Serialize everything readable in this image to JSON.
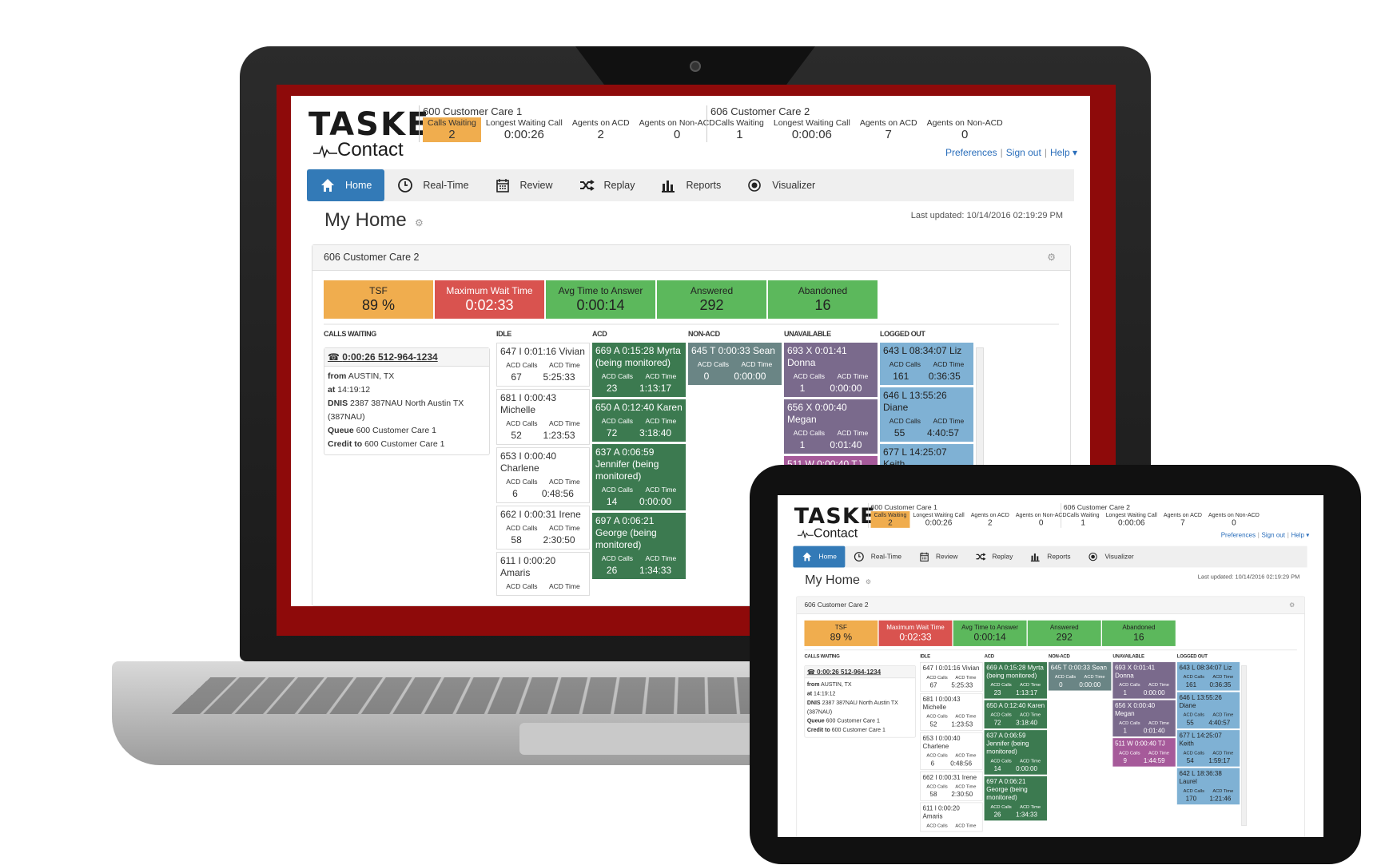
{
  "logo": {
    "line1": "TASKE",
    "line2": "Contact"
  },
  "queues": [
    {
      "title": "600 Customer Care 1",
      "stats": [
        {
          "label": "Calls Waiting",
          "value": "2",
          "highlight": true
        },
        {
          "label": "Longest Waiting Call",
          "value": "0:00:26"
        },
        {
          "label": "Agents on ACD",
          "value": "2"
        },
        {
          "label": "Agents on Non-ACD",
          "value": "0"
        }
      ]
    },
    {
      "title": "606 Customer Care 2",
      "stats": [
        {
          "label": "Calls Waiting",
          "value": "1"
        },
        {
          "label": "Longest Waiting Call",
          "value": "0:00:06"
        },
        {
          "label": "Agents on ACD",
          "value": "7"
        },
        {
          "label": "Agents on Non-ACD",
          "value": "0"
        }
      ]
    }
  ],
  "toplinks": {
    "preferences": "Preferences",
    "signout": "Sign out",
    "help": "Help ▾"
  },
  "nav": [
    {
      "label": "Home",
      "icon": "home-icon",
      "active": true
    },
    {
      "label": "Real-Time",
      "icon": "clock-icon"
    },
    {
      "label": "Review",
      "icon": "calendar-icon"
    },
    {
      "label": "Replay",
      "icon": "shuffle-icon"
    },
    {
      "label": "Reports",
      "icon": "bar-chart-icon"
    },
    {
      "label": "Visualizer",
      "icon": "eye-icon"
    }
  ],
  "page": {
    "title": "My Home",
    "gear": "⚙",
    "last_updated": "Last updated: 10/14/2016 02:19:29 PM"
  },
  "panel": {
    "title": "606 Customer Care 2",
    "gear": "⚙"
  },
  "kpis": [
    {
      "label": "TSF",
      "value": "89 %",
      "color": "orange"
    },
    {
      "label": "Maximum Wait Time",
      "value": "0:02:33",
      "color": "red"
    },
    {
      "label": "Avg Time to Answer",
      "value": "0:00:14",
      "color": "green"
    },
    {
      "label": "Answered",
      "value": "292",
      "color": "green"
    },
    {
      "label": "Abandoned",
      "value": "16",
      "color": "green"
    }
  ],
  "columns": {
    "calls_waiting": "CALLS WAITING",
    "idle": "IDLE",
    "acd": "ACD",
    "nonacd": "NON-ACD",
    "unavailable": "UNAVAILABLE",
    "logged_out": "LOGGED OUT"
  },
  "call": {
    "header": "0:00:26  512-964-1234",
    "from_label": "from",
    "from": "AUSTIN, TX",
    "at_label": "at",
    "at": "14:19:12",
    "dnis_label": "DNIS",
    "dnis": "2387 387NAU North Austin TX (387NAU)",
    "queue_label": "Queue",
    "queue": "600 Customer Care 1",
    "credit_label": "Credit to",
    "credit": "600 Customer Care 1"
  },
  "mini_labels": {
    "calls": "ACD Calls",
    "time": "ACD Time"
  },
  "agents": {
    "idle": [
      {
        "title": "647 I 0:01:16 Vivian",
        "calls": "67",
        "time": "5:25:33"
      },
      {
        "title": "681 I 0:00:43 Michelle",
        "calls": "52",
        "time": "1:23:53"
      },
      {
        "title": "653 I 0:00:40 Charlene",
        "calls": "6",
        "time": "0:48:56"
      },
      {
        "title": "662 I 0:00:31 Irene",
        "calls": "58",
        "time": "2:30:50"
      },
      {
        "title": "611 I 0:00:20 Amaris",
        "calls": "",
        "time": ""
      }
    ],
    "acd": [
      {
        "title": "669 A 0:15:28 Myrta (being monitored)",
        "calls": "23",
        "time": "1:13:17"
      },
      {
        "title": "650 A 0:12:40 Karen",
        "calls": "72",
        "time": "3:18:40"
      },
      {
        "title": "637 A 0:06:59 Jennifer (being monitored)",
        "calls": "14",
        "time": "0:00:00"
      },
      {
        "title": "697 A 0:06:21 George (being monitored)",
        "calls": "26",
        "time": "1:34:33"
      }
    ],
    "nonacd": [
      {
        "title": "645 T 0:00:33 Sean",
        "calls": "0",
        "time": "0:00:00"
      }
    ],
    "unavailable": [
      {
        "title": "693 X 0:01:41 Donna",
        "calls": "1",
        "time": "0:00:00"
      },
      {
        "title": "656 X 0:00:40 Megan",
        "calls": "1",
        "time": "0:01:40"
      },
      {
        "title": "511 W 0:00:40 TJ",
        "calls": "9",
        "time": "1:44:59",
        "wrap": true
      }
    ],
    "logged_out": [
      {
        "title": "643 L 08:34:07 Liz",
        "calls": "161",
        "time": "0:36:35"
      },
      {
        "title": "646 L 13:55:26 Diane",
        "calls": "55",
        "time": "4:40:57"
      },
      {
        "title": "677 L 14:25:07 Keith",
        "calls": "54",
        "time": "1:59:17"
      },
      {
        "title": "642 L 18:36:38 Laurel",
        "calls": "170",
        "time": "1:21:46"
      }
    ]
  }
}
